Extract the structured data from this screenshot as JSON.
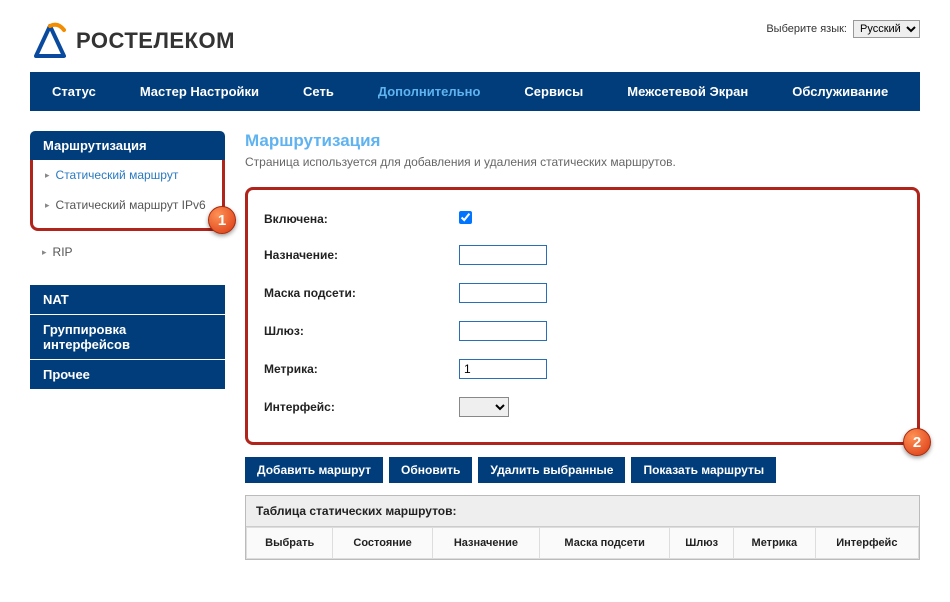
{
  "lang": {
    "label": "Выберите язык:",
    "selected": "Русский"
  },
  "brand": "РОСТЕЛЕКОМ",
  "nav": {
    "status": "Статус",
    "wizard": "Мастер Настройки",
    "network": "Сеть",
    "advanced": "Дополнительно",
    "services": "Сервисы",
    "firewall": "Межсетевой Экран",
    "maintenance": "Обслуживание"
  },
  "sidebar": {
    "routing": "Маршрутизация",
    "static_route": "Статический маршрут",
    "static_route_ipv6": "Статический маршрут IPv6",
    "rip": "RIP",
    "nat": "NAT",
    "if_group": "Группировка интерфейсов",
    "other": "Прочее"
  },
  "page": {
    "title": "Маршрутизация",
    "sub": "Страница используется для добавления и удаления статических маршрутов."
  },
  "form": {
    "enabled": "Включена:",
    "destination": "Назначение:",
    "netmask": "Маска подсети:",
    "gateway": "Шлюз:",
    "metric": "Метрика:",
    "metric_value": "1",
    "interface": "Интерфейс:"
  },
  "buttons": {
    "add": "Добавить маршрут",
    "update": "Обновить",
    "delete": "Удалить выбранные",
    "show": "Показать маршруты"
  },
  "table": {
    "title": "Таблица статических маршрутов:",
    "cols": {
      "select": "Выбрать",
      "state": "Состояние",
      "dest": "Назначение",
      "mask": "Маска подсети",
      "gw": "Шлюз",
      "metric": "Метрика",
      "iface": "Интерфейс"
    }
  },
  "markers": {
    "m1": "1",
    "m2": "2"
  }
}
